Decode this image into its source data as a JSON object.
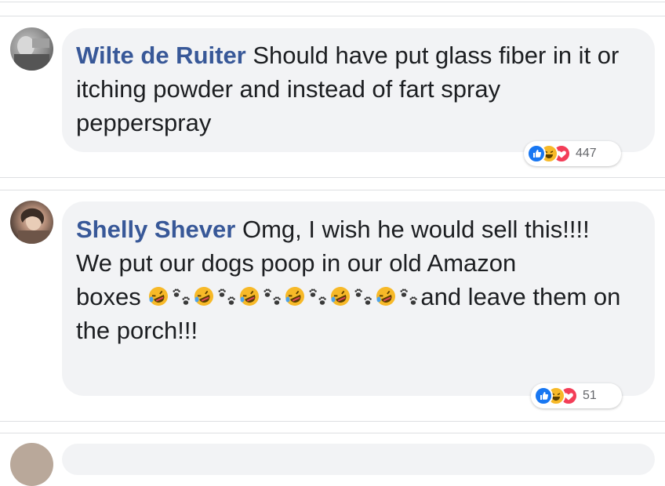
{
  "comments": [
    {
      "author": "Wilte de Ruiter",
      "text": " Should have put glass fiber in it or itching powder and instead of fart spray pepperspray",
      "reactions": {
        "icons": [
          "like",
          "haha",
          "love"
        ],
        "count": "447"
      }
    },
    {
      "author": "Shelly Shever",
      "line1": " Omg, I wish he would sell this!!!!",
      "line2": "We put our dogs poop in our old Amazon",
      "line3_prefix": "boxes ",
      "emoji_sequence": [
        "rofl",
        "paw",
        "rofl",
        "paw",
        "rofl",
        "paw",
        "rofl",
        "paw",
        "rofl",
        "paw",
        "rofl",
        "paw"
      ],
      "line3_suffix": "and leave them on the porch!!!",
      "reactions": {
        "icons": [
          "like",
          "haha",
          "love"
        ],
        "count": "51"
      }
    }
  ],
  "colors": {
    "author": "#385898",
    "bubble": "#f2f3f5",
    "like": "#1877f2",
    "haha": "#f7b928",
    "love": "#f33e58"
  }
}
